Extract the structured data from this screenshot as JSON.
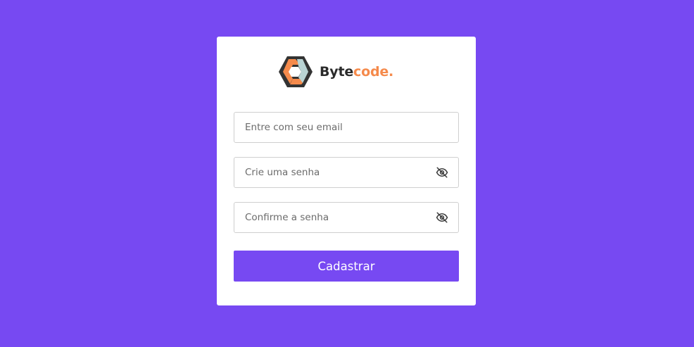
{
  "colors": {
    "background": "#7749F2",
    "card": "#FFFFFF",
    "brand_accent": "#F58A4B",
    "brand_dark": "#2B2B2B",
    "button": "#7749F2"
  },
  "brand": {
    "logo_icon": "hexagon-logo-icon",
    "name_main": "Byte",
    "name_accent": "code."
  },
  "form": {
    "email": {
      "placeholder": "Entre com seu email",
      "value": ""
    },
    "password": {
      "placeholder": "Crie uma senha",
      "value": "",
      "toggle_icon": "eye-off-icon"
    },
    "confirm": {
      "placeholder": "Confirme a senha",
      "value": "",
      "toggle_icon": "eye-off-icon"
    },
    "submit_label": "Cadastrar"
  }
}
